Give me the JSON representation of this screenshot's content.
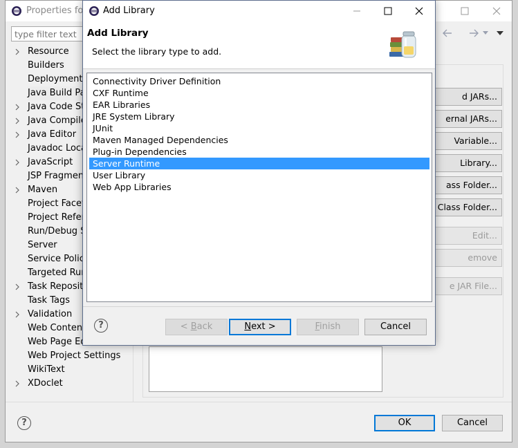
{
  "properties_window": {
    "title": "Properties for",
    "filter_placeholder": "type filter text",
    "tree": [
      {
        "label": "Resource",
        "expandable": true
      },
      {
        "label": "Builders",
        "expandable": false
      },
      {
        "label": "Deployment A",
        "expandable": false
      },
      {
        "label": "Java Build Pat",
        "expandable": false,
        "selected": true
      },
      {
        "label": "Java Code Sty",
        "expandable": true
      },
      {
        "label": "Java Compiler",
        "expandable": true
      },
      {
        "label": "Java Editor",
        "expandable": true
      },
      {
        "label": "Javadoc Locat",
        "expandable": false
      },
      {
        "label": "JavaScript",
        "expandable": true
      },
      {
        "label": "JSP Fragment",
        "expandable": false
      },
      {
        "label": "Maven",
        "expandable": true
      },
      {
        "label": "Project Facets",
        "expandable": false
      },
      {
        "label": "Project Refere",
        "expandable": false
      },
      {
        "label": "Run/Debug Se",
        "expandable": false
      },
      {
        "label": "Server",
        "expandable": false
      },
      {
        "label": "Service Policie",
        "expandable": false
      },
      {
        "label": "Targeted Run",
        "expandable": false
      },
      {
        "label": "Task Reposito",
        "expandable": true
      },
      {
        "label": "Task Tags",
        "expandable": false
      },
      {
        "label": "Validation",
        "expandable": true
      },
      {
        "label": "Web Content",
        "expandable": false
      },
      {
        "label": "Web Page Ed",
        "expandable": false
      },
      {
        "label": "Web Project Settings",
        "expandable": false
      },
      {
        "label": "WikiText",
        "expandable": false
      },
      {
        "label": "XDoclet",
        "expandable": true
      }
    ],
    "side_buttons": [
      {
        "label": "d JARs...",
        "enabled": true
      },
      {
        "label": "ernal JARs...",
        "enabled": true
      },
      {
        "label": "Variable...",
        "enabled": true
      },
      {
        "label": "Library...",
        "enabled": true
      },
      {
        "label": "ass Folder...",
        "enabled": true
      },
      {
        "label": "al Class Folder...",
        "enabled": true
      },
      {
        "label": "Edit...",
        "enabled": false
      },
      {
        "label": "emove",
        "enabled": false
      },
      {
        "label": "e JAR File...",
        "enabled": false
      }
    ],
    "ok_label": "OK",
    "cancel_label": "Cancel",
    "help_glyph": "?"
  },
  "dialog": {
    "title": "Add Library",
    "heading": "Add Library",
    "description": "Select the library type to add.",
    "library_types": [
      "Connectivity Driver Definition",
      "CXF Runtime",
      "EAR Libraries",
      "JRE System Library",
      "JUnit",
      "Maven Managed Dependencies",
      "Plug-in Dependencies",
      "Server Runtime",
      "User Library",
      "Web App Libraries"
    ],
    "selected_index": 7,
    "buttons": {
      "back": {
        "mnemonic": "B",
        "prefix": "< ",
        "rest": "ack",
        "enabled": false
      },
      "next": {
        "mnemonic": "N",
        "prefix": "",
        "rest": "ext >",
        "enabled": true
      },
      "finish": {
        "mnemonic": "F",
        "prefix": "",
        "rest": "inish",
        "enabled": false
      },
      "cancel": {
        "label": "Cancel",
        "enabled": true
      }
    },
    "help_glyph": "?"
  },
  "colors": {
    "selection": "#3399ff",
    "default_button_border": "#0078d7",
    "accent_blue": "#1a4e9e"
  }
}
